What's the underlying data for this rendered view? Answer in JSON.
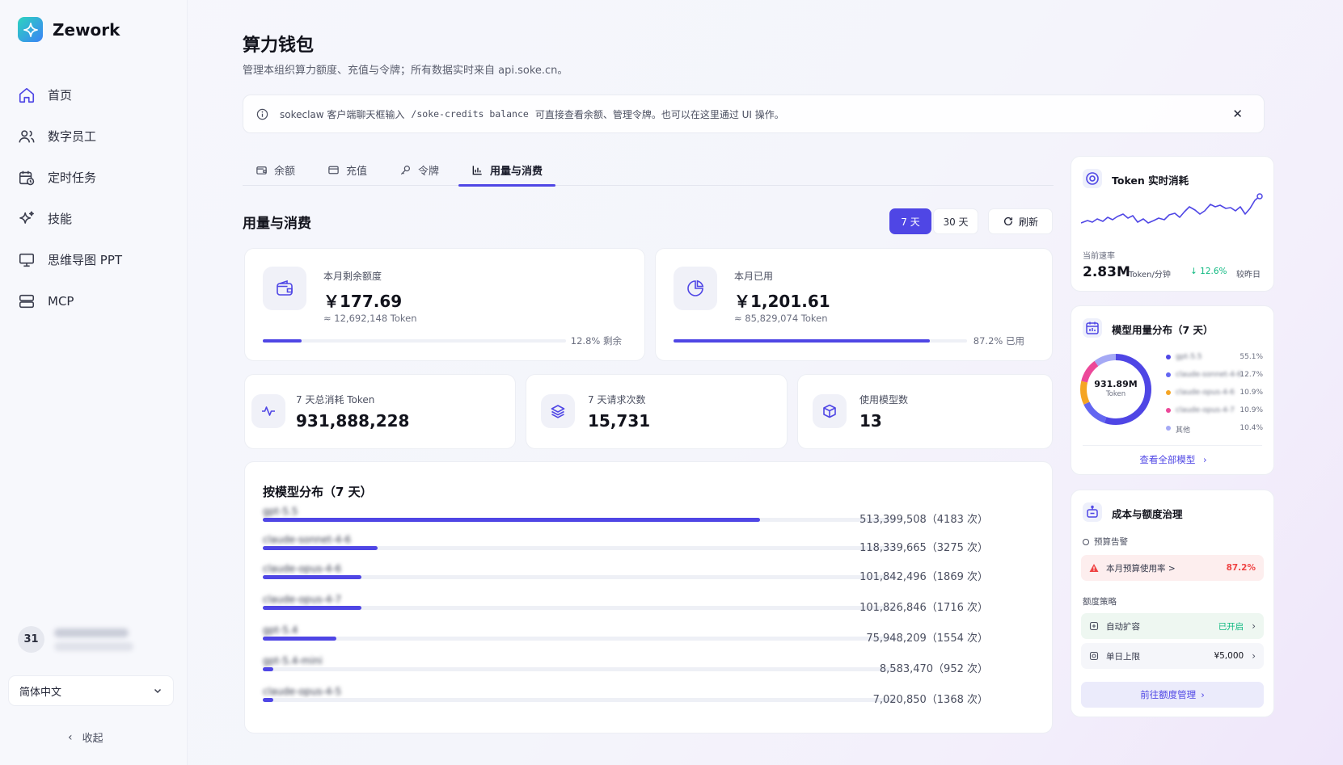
{
  "app": {
    "name": "Zework"
  },
  "sidebar": {
    "items": [
      {
        "label": "首页",
        "icon": "home-icon"
      },
      {
        "label": "数字员工",
        "icon": "users-icon"
      },
      {
        "label": "定时任务",
        "icon": "calendar-clock-icon"
      },
      {
        "label": "技能",
        "icon": "sparkles-icon"
      },
      {
        "label": "思维导图 PPT",
        "icon": "presentation-icon"
      },
      {
        "label": "MCP",
        "icon": "server-icon"
      }
    ],
    "user_avatar": "31",
    "language": "简体中文",
    "collapse_label": "收起"
  },
  "page": {
    "title": "算力钱包",
    "subtitle": "管理本组织算力额度、充值与令牌；所有数据实时来自 api.soke.cn。"
  },
  "info_bar": {
    "prefix": "sokeclaw 客户端聊天框输入",
    "code": "/soke-credits balance",
    "suffix": "可直接查看余额、管理令牌。也可以在这里通过 UI 操作。",
    "close": "✕"
  },
  "tabs": [
    {
      "label": "余额",
      "icon": "wallet-icon"
    },
    {
      "label": "充值",
      "icon": "card-icon"
    },
    {
      "label": "令牌",
      "icon": "key-icon"
    },
    {
      "label": "用量与消费",
      "icon": "bar-chart-icon",
      "active": true
    }
  ],
  "usage": {
    "section_title": "用量与消费",
    "range_7": "7 天",
    "range_30": "30 天",
    "refresh": "刷新",
    "remaining": {
      "label": "本月剩余额度",
      "value": "￥177.69",
      "tokens": "≈ 12,692,148 Token",
      "pct_text": "12.8% 剩余",
      "pct": 12.8
    },
    "used": {
      "label": "本月已用",
      "value": "￥1,201.61",
      "tokens": "≈ 85,829,074 Token",
      "pct_text": "87.2% 已用",
      "pct": 87.2
    },
    "total_tokens": {
      "label": "7 天总消耗 Token",
      "value": "931,888,228"
    },
    "requests": {
      "label": "7 天请求次数",
      "value": "15,731"
    },
    "models_used": {
      "label": "使用模型数",
      "value": "13"
    }
  },
  "distribution": {
    "title": "按模型分布（7 天）",
    "rows": [
      {
        "name": "gpt-5.5",
        "value": "513,399,508（4183 次）",
        "tokens": 513399508
      },
      {
        "name": "claude-sonnet-4-6",
        "value": "118,339,665（3275 次）",
        "tokens": 118339665
      },
      {
        "name": "claude-opus-4-6",
        "value": "101,842,496（1869 次）",
        "tokens": 101842496
      },
      {
        "name": "claude-opus-4-7",
        "value": "101,826,846（1716 次）",
        "tokens": 101826846
      },
      {
        "name": "gpt-5.4",
        "value": "75,948,209（1554 次）",
        "tokens": 75948209
      },
      {
        "name": "gpt-5.4-mini",
        "value": "8,583,470（952 次）",
        "tokens": 8583470
      },
      {
        "name": "claude-opus-4-5",
        "value": "7,020,850（1368 次）",
        "tokens": 7020850
      }
    ]
  },
  "realtime": {
    "title": "Token 实时消耗",
    "rate_label": "当前速率",
    "rate_value": "2.83M",
    "rate_unit": "Token/分钟",
    "change": "↓ 12.6%",
    "change_suffix": "较昨日",
    "accent": "#4f46e5",
    "down_color": "#10b981"
  },
  "model_usage": {
    "title": "模型用量分布（7 天）",
    "center_value": "931.89M",
    "center_unit": "Token",
    "link": "查看全部模型",
    "legend": [
      {
        "name": "gpt-5.5",
        "pct": "55.1%",
        "share": 55.1,
        "color": "#4f46e5"
      },
      {
        "name": "claude-sonnet-4-6",
        "pct": "12.7%",
        "share": 12.7,
        "color": "#6366f1"
      },
      {
        "name": "claude-opus-4-6",
        "pct": "10.9%",
        "share": 10.9,
        "color": "#f5a524"
      },
      {
        "name": "claude-opus-4-7",
        "pct": "10.9%",
        "share": 10.9,
        "color": "#ec4899"
      },
      {
        "name": "其他",
        "pct": "10.4%",
        "share": 10.4,
        "color": "#a5a9f5"
      }
    ]
  },
  "cost": {
    "title": "成本与额度治理",
    "budget_label": "预算告警",
    "budget_alert": "本月预算使用率 >",
    "budget_pct": "87.2%",
    "policy_label": "额度策略",
    "auto_expand": "自动扩容",
    "auto_status": "已开启",
    "daily_cap": "单日上限",
    "daily_value": "¥5,000",
    "manage_link": "前往额度管理"
  }
}
